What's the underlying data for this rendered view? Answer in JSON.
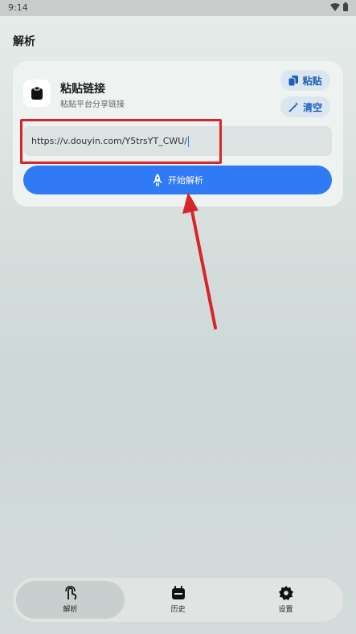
{
  "status_bar": {
    "time": "9:14",
    "wifi_icon": "wifi-icon",
    "battery_icon": "battery-icon"
  },
  "page": {
    "title": "解析"
  },
  "card": {
    "title": "粘贴链接",
    "subtitle": "粘贴平台分享链接",
    "icon": "clipboard-icon",
    "paste_label": "粘贴",
    "clear_label": "清空",
    "url_value": "https://v.douyin.com/Y5trsYT_CWU/",
    "parse_label": "开始解析"
  },
  "colors": {
    "accent": "#2f7bf6",
    "highlight": "#d7252c"
  },
  "bottom_nav": {
    "items": [
      {
        "label": "解析",
        "icon": "touch-icon",
        "active": true
      },
      {
        "label": "历史",
        "icon": "calendar-icon",
        "active": false
      },
      {
        "label": "设置",
        "icon": "gear-icon",
        "active": false
      }
    ]
  }
}
